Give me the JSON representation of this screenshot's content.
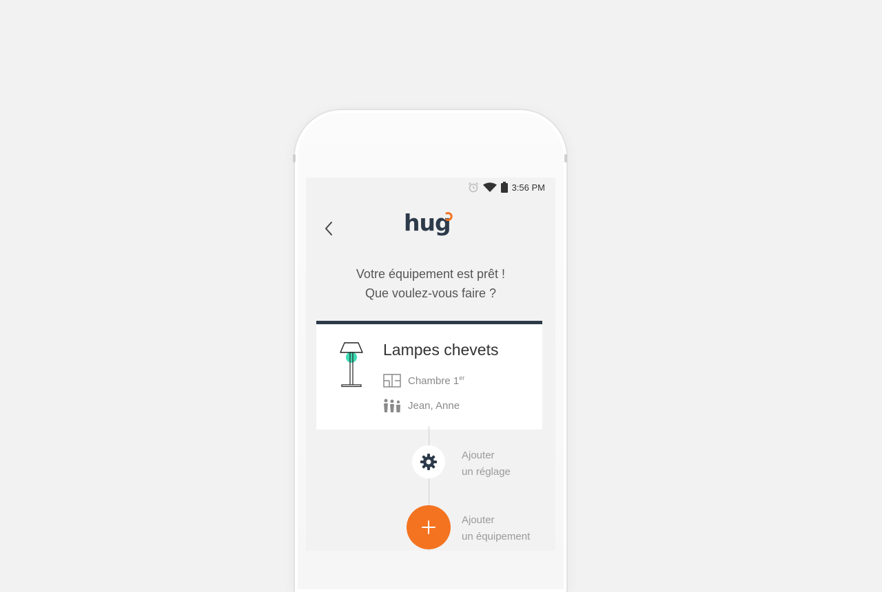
{
  "status_bar": {
    "time": "3:56 PM",
    "icons": [
      "alarm-icon",
      "wifi-icon",
      "battery-icon"
    ]
  },
  "header": {
    "back_icon": "chevron-left-icon",
    "logo_text": "hug"
  },
  "prompt": {
    "line1": "Votre équipement est prêt !",
    "line2": "Que voulez-vous faire ?"
  },
  "device": {
    "name": "Lampes chevets",
    "room": "Chambre 1",
    "room_suffix": "er",
    "users": "Jean, Anne"
  },
  "actions": {
    "add_setting_line1": "Ajouter",
    "add_setting_line2": "un réglage",
    "add_device_line1": "Ajouter",
    "add_device_line2": "un équipement"
  },
  "colors": {
    "accent": "#f47321",
    "dark": "#2d3a4a",
    "lamp_light": "#3ddcb4",
    "background": "#f2f2f2"
  }
}
